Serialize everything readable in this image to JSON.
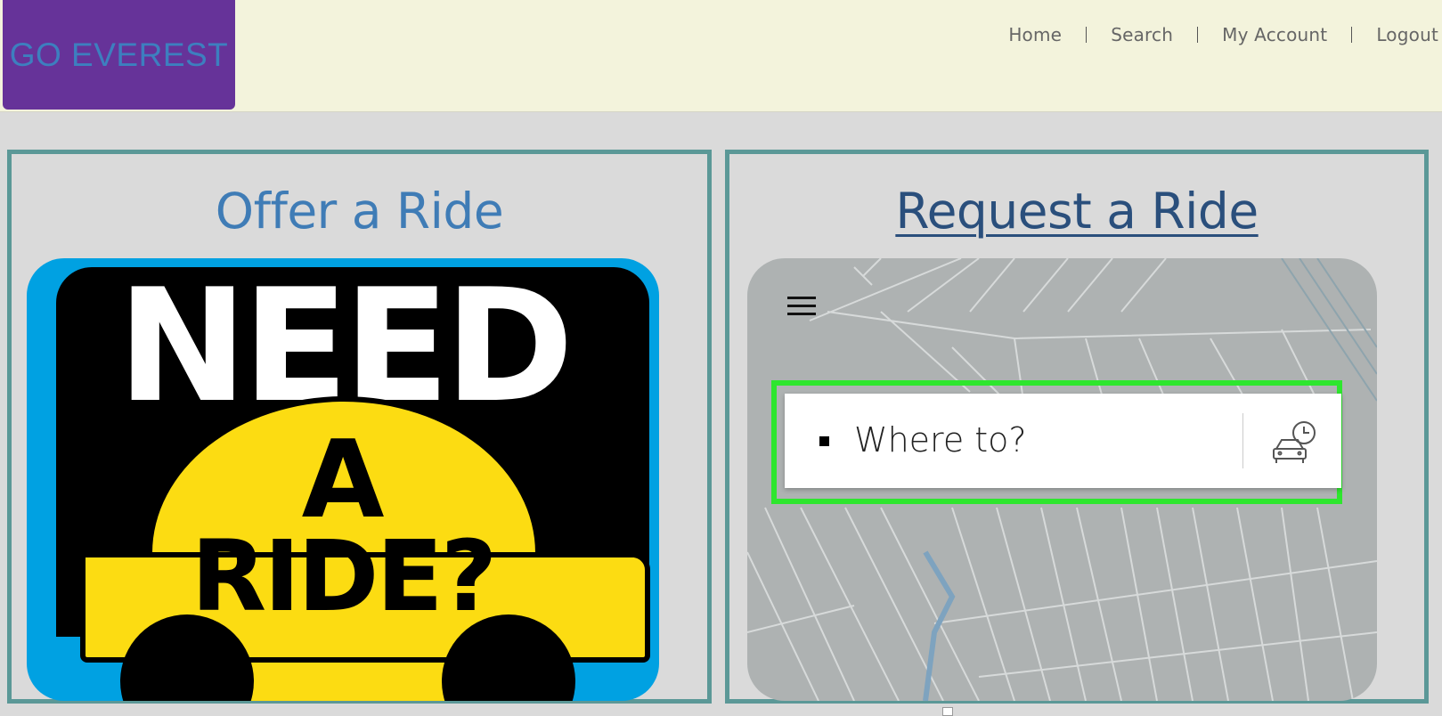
{
  "logo": {
    "text": "GO EVEREST"
  },
  "nav": [
    {
      "label": "Home"
    },
    {
      "label": "Search"
    },
    {
      "label": "My Account"
    },
    {
      "label": "Logout"
    }
  ],
  "offer": {
    "title": "Offer a Ride",
    "image": {
      "line1": "NEED",
      "line2": "A",
      "line3": "RIDE?"
    }
  },
  "request": {
    "title": "Request a Ride",
    "search_placeholder": "Where to?"
  },
  "colors": {
    "logo_bg": "#663399",
    "logo_text": "#3d7fbf",
    "panel_border": "#5b9897",
    "highlight": "#2ee62e",
    "topbar_bg": "#f3f3dc"
  },
  "icons": [
    "hamburger-menu-icon",
    "schedule-ride-icon",
    "destination-bullet-icon"
  ]
}
